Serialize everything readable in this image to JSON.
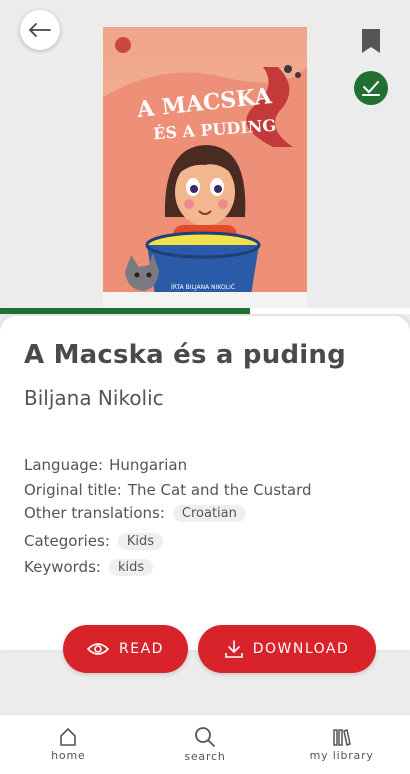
{
  "book": {
    "cover_title_line1": "A MACSKA",
    "cover_title_line2": "ÉS A PUDING",
    "cover_credit": "ÍRTA BILJANA NIKOLIĆ",
    "title": "A Macska és a puding",
    "author": "Biljana Nikolic",
    "read_progress": 0.61
  },
  "details": {
    "language_label": "Language:",
    "language_value": "Hungarian",
    "original_title_label": "Original title:",
    "original_title_value": "The Cat and the Custard",
    "translations_label": "Other translations:",
    "translations": [
      "Croatian"
    ],
    "categories_label": "Categories:",
    "categories": [
      "Kids"
    ],
    "keywords_label": "Keywords:",
    "keywords": [
      "kids"
    ]
  },
  "actions": {
    "read_label": "READ",
    "download_label": "DOWNLOAD"
  },
  "nav": {
    "home": "home",
    "search": "search",
    "library": "my library"
  },
  "colors": {
    "accent_red": "#d8232a",
    "accent_green": "#207032"
  },
  "icons": [
    "arrow-left-icon",
    "bookmark-icon",
    "check-icon",
    "eye-icon",
    "download-icon",
    "home-icon",
    "search-icon",
    "library-icon"
  ]
}
